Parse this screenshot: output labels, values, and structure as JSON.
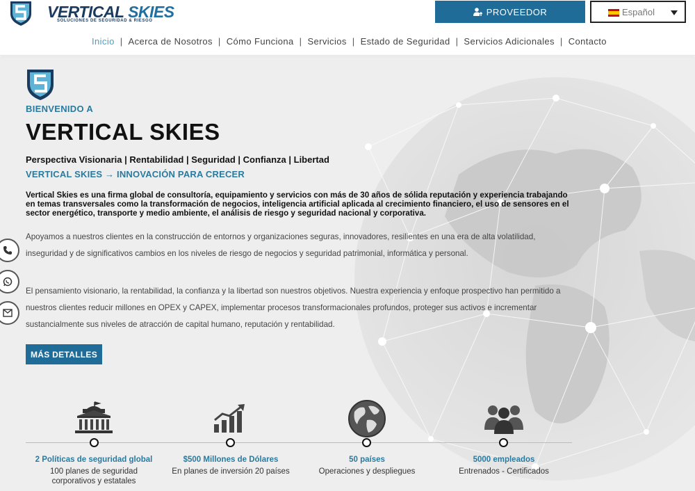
{
  "header": {
    "logo_text_a": "VERTICAL ",
    "logo_text_b": "SKIES",
    "logo_sub": "SOLUCIONES DE SEGURIDAD & RIESGO",
    "proveedor_label": "PROVEEDOR",
    "language": "Español"
  },
  "nav": {
    "items": [
      "Inicio",
      "Acerca de Nosotros",
      "Cómo Funciona",
      "Servicios",
      "Estado de Seguridad",
      "Servicios Adicionales",
      "Contacto"
    ],
    "separator": "|"
  },
  "hero": {
    "welcome": "BIENVENIDO A",
    "title": "VERTICAL SKIES",
    "tagline": "Perspectiva Visionaria | Rentabilidad | Seguridad | Confianza | Libertad",
    "subtitle": "VERTICAL SKIES → INNOVACIÓN PARA CRECER",
    "intro": "Vertical Skies es una firma global de consultoría, equipamiento y servicios con más de 30 años de sólida reputación y experiencia trabajando en temas transversales como la transformación de negocios, inteligencia artificial aplicada al crecimiento financiero, el uso de sensores en el sector energético, transporte y medio ambiente, el análisis de riesgo y seguridad nacional y corporativa.",
    "para1": "Apoyamos a nuestros clientes en la construcción de entornos y organizaciones seguras, innovadores, resilientes en una era de alta volatilidad, inseguridad y de significativos cambios en los niveles de riesgo de negocios y seguridad patrimonial, informática y personal.",
    "para2": "El pensamiento visionario, la rentabilidad, la confianza y la libertad son nuestros objetivos. Nuestra experiencia y enfoque prospectivo han permitido a nuestros clientes reducir millones en OPEX y CAPEX, implementar procesos transformacionales profundos, proteger sus activos e incrementar sustancialmente sus niveles de atracción de capital humano, reputación y rentabilidad.",
    "details_button": "MÁS DETALLES"
  },
  "side_icons": [
    "phone-icon",
    "whatsapp-icon",
    "email-icon"
  ],
  "stats": [
    {
      "icon": "government-building-icon",
      "title": "2 Políticas de seguridad global",
      "desc": "100 planes de seguridad corporativos y estatales"
    },
    {
      "icon": "growth-chart-icon",
      "title": "$500 Millones de Dólares",
      "desc": "En planes de inversión 20 países"
    },
    {
      "icon": "globe-icon",
      "title": "50 países",
      "desc": "Operaciones y despliegues"
    },
    {
      "icon": "team-icon",
      "title": "5000 empleados",
      "desc": "Entrenados - Certificados"
    }
  ],
  "colors": {
    "accent": "#1f6c99",
    "accent_text": "#2a7a9e",
    "nav_active": "#4a9fc0",
    "hero_bg": "#eeeeee"
  }
}
